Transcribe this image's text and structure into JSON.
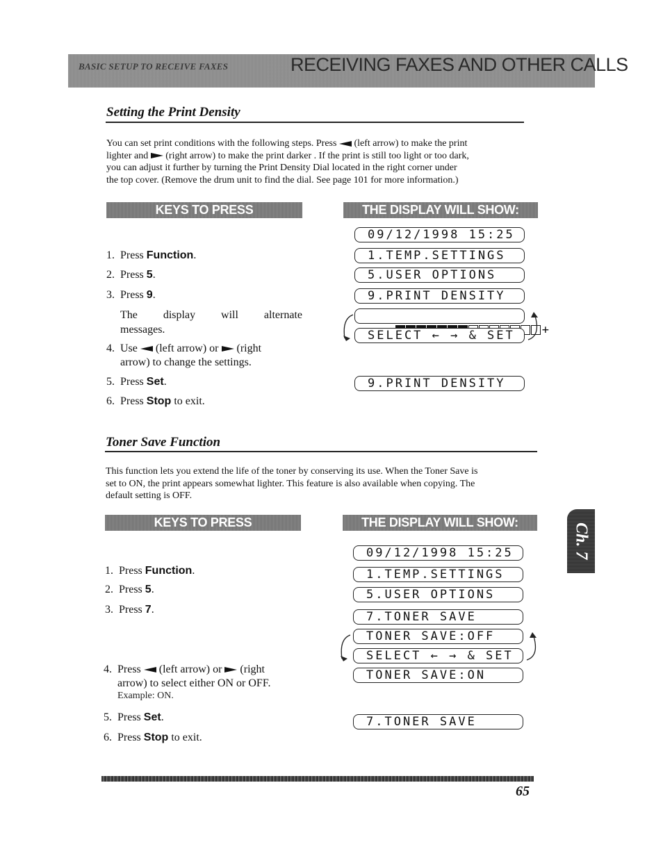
{
  "header": {
    "subtitle": "BASIC SETUP TO RECEIVE FAXES",
    "title": "RECEIVING FAXES AND OTHER CALLS"
  },
  "section1": {
    "title": "Setting the Print Density",
    "intro": [
      {
        "before": "You can set print conditions with the following steps. Press ",
        "icon": "left-arrow",
        "after": " (left arrow) to make the print"
      },
      {
        "before": "lighter and ",
        "icon": "right-arrow",
        "after": " (right arrow) to make the print darker . If the print is still too light or too dark,"
      },
      {
        "before": "you can adjust it further by turning the Print Density Dial located in the right corner under",
        "icon": null,
        "after": ""
      },
      {
        "before": "the top cover. (Remove the drum unit to find the dial. See page 101 for more information.)",
        "icon": null,
        "after": ""
      }
    ],
    "keys_header": "KEYS TO PRESS",
    "display_header": "THE DISPLAY WILL SHOW:",
    "steps": [
      {
        "num": "1.",
        "pre": "Press ",
        "bold": "Function",
        "post": "."
      },
      {
        "num": "2.",
        "pre": "Press ",
        "bold": "5",
        "post": "."
      },
      {
        "num": "3.",
        "pre": "Press ",
        "bold": "9",
        "post": "."
      },
      {
        "num": "",
        "pre": "The display will alternate messages.",
        "bold": "",
        "post": ""
      },
      {
        "num": "4.",
        "pre": "Use ",
        "bold": "",
        "post": "(left arrow) or (right arrow) to change the settings."
      },
      {
        "num": "5.",
        "pre": "Press ",
        "bold": "Set",
        "post": "."
      },
      {
        "num": "6.",
        "pre": "Press ",
        "bold": "Stop",
        "post": " to exit."
      }
    ],
    "step4": {
      "num": "4.",
      "a": "Use ",
      "b": " (left arrow) or ",
      "c": " (right",
      "d": "arrow) to change the settings."
    },
    "step3_note_line1": "The display will alternate",
    "step3_note_line2": "messages.",
    "displays": {
      "datetime": "09/12/1998 15:25",
      "menu1": "1.TEMP.SETTINGS",
      "menu5": "5.USER OPTIONS",
      "menu9": "9.PRINT DENSITY",
      "density_minus": "-",
      "density_plus": "+",
      "density_level": 7,
      "density_max": 14,
      "select": "SELECT ← → & SET",
      "final": "9.PRINT DENSITY"
    }
  },
  "section2": {
    "title": "Toner Save Function",
    "intro": [
      "This function lets you extend the life of the toner by conserving its use. When the Toner Save is",
      "set to ON, the print appears somewhat lighter. This feature is also available when copying. The",
      "default setting is OFF."
    ],
    "keys_header": "KEYS TO PRESS",
    "display_header": "THE DISPLAY WILL SHOW:",
    "steps": {
      "s1": {
        "num": "1.",
        "pre": "Press ",
        "bold": "Function",
        "post": "."
      },
      "s2": {
        "num": "2.",
        "pre": "Press ",
        "bold": "5",
        "post": "."
      },
      "s3": {
        "num": "3.",
        "pre": "Press ",
        "bold": "7",
        "post": "."
      },
      "s4": {
        "num": "4.",
        "a": "Press ",
        "b": " (left arrow) or ",
        "c": " (right",
        "d": "arrow) to select either ON or OFF.",
        "example": "Example: ON."
      },
      "s5": {
        "num": "5.",
        "pre": "Press ",
        "bold": "Set",
        "post": "."
      },
      "s6": {
        "num": "6.",
        "pre": "Press ",
        "bold": "Stop",
        "post": " to exit."
      }
    },
    "displays": {
      "datetime": "09/12/1998 15:25",
      "menu1": "1.TEMP.SETTINGS",
      "menu5": "5.USER OPTIONS",
      "menu7": "7.TONER SAVE",
      "off": "TONER SAVE:OFF",
      "select": "SELECT ← → & SET",
      "on": "TONER SAVE:ON",
      "final": "7.TONER SAVE"
    }
  },
  "chapter_tab": "Ch. 7",
  "page_number": "65"
}
